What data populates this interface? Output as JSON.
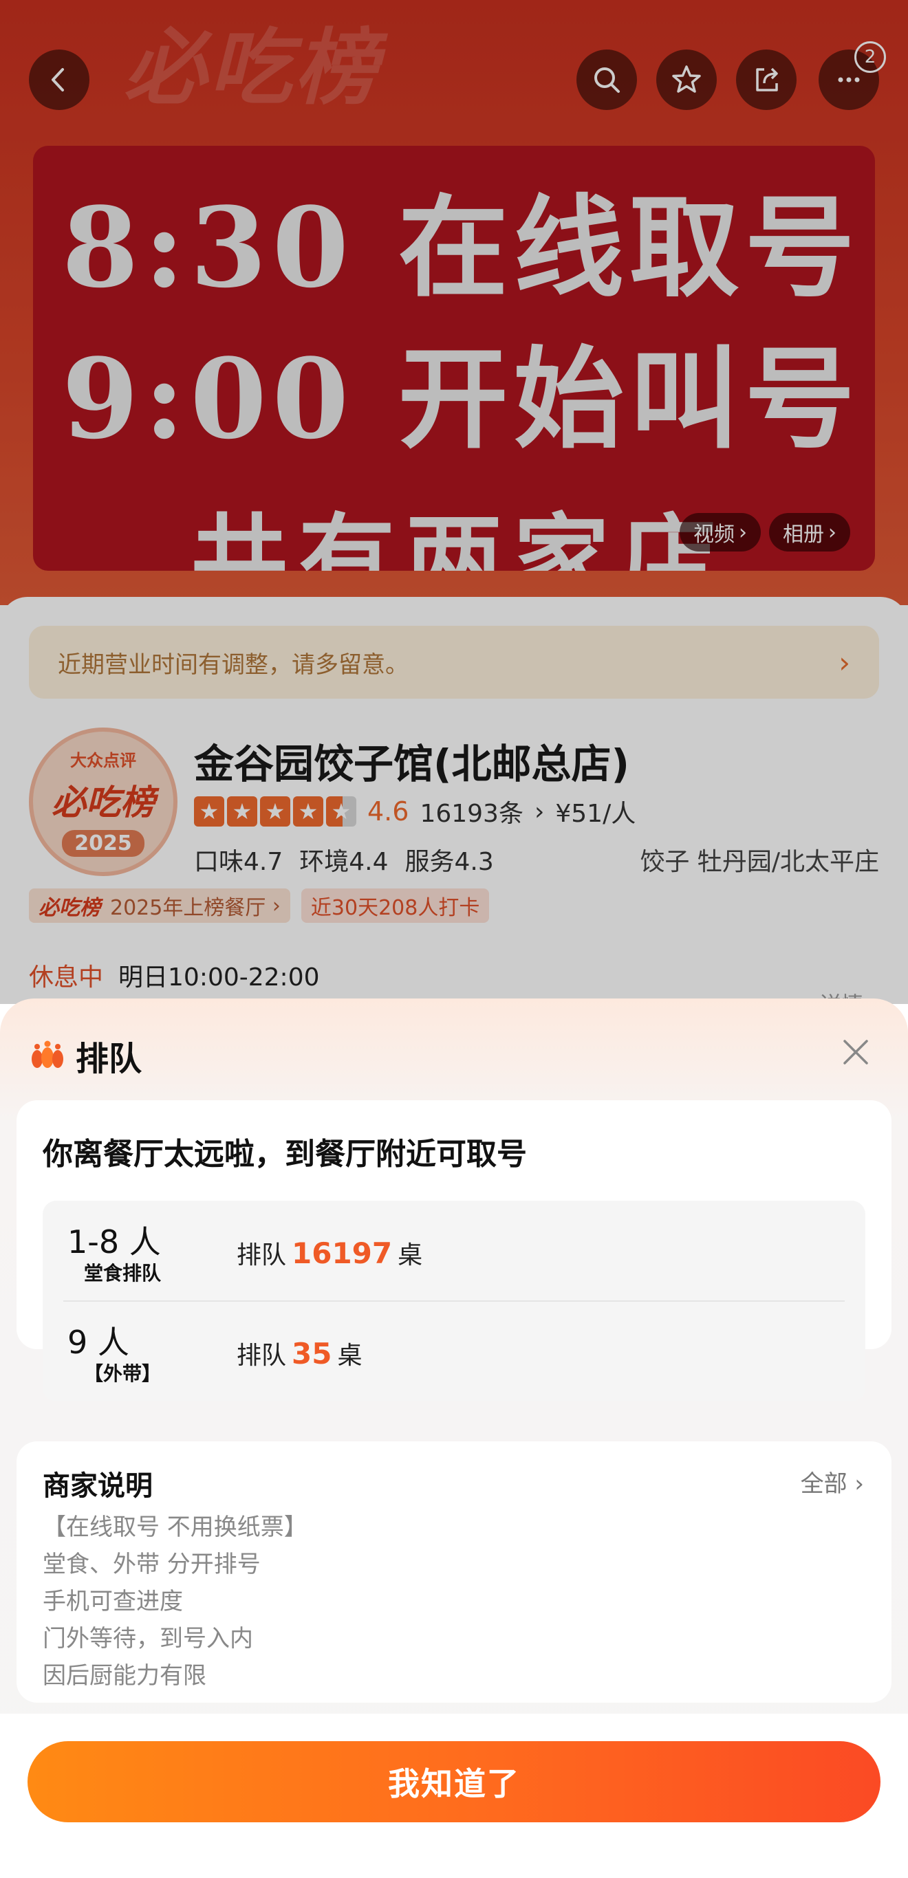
{
  "header": {
    "brand_watermark": "必吃榜",
    "more_badge": "2",
    "icons": [
      "back-icon",
      "search-icon",
      "star-icon",
      "share-icon",
      "more-icon"
    ]
  },
  "banner": {
    "line1": "8:30 在线取号",
    "line2": "9:00 开始叫号",
    "line3": "共有两家店",
    "video_label": "视频",
    "album_label": "相册"
  },
  "notice": {
    "text": "近期营业时间有调整，请多留意。"
  },
  "shop": {
    "badge_top": "大众点评",
    "badge_mid": "必吃榜",
    "badge_year": "2025",
    "name": "金谷园饺子馆(北邮总店)",
    "rating": "4.6",
    "rating_stars": 4.5,
    "reviews": "16193条",
    "price": "¥51/人",
    "taste": "口味4.7",
    "env": "环境4.4",
    "service": "服务4.3",
    "category_area": "饺子 牡丹园/北太平庄",
    "tag_logo": "必吃榜",
    "tag_list": "2025年上榜餐厅",
    "tag_checkin": "近30天208人打卡",
    "status": "休息中",
    "hours": "明日10:00-22:00",
    "detail_link": "详情"
  },
  "sheet": {
    "title": "排队",
    "distance_notice": "你离餐厅太远啦，到餐厅附近可取号",
    "queues": [
      {
        "size": "1-8 人",
        "type": "堂食排队",
        "prefix": "排队",
        "count": "16197",
        "suffix": "桌"
      },
      {
        "size": "9 人",
        "type": "【外带】",
        "prefix": "排队",
        "count": "35",
        "suffix": "桌"
      }
    ],
    "merchant": {
      "title": "商家说明",
      "all_label": "全部",
      "lines": [
        "【在线取号  不用换纸票】",
        "堂食、外带 分开排号",
        "手机可查进度",
        "门外等待，到号入内",
        "因后厨能力有限"
      ]
    },
    "confirm_label": "我知道了"
  },
  "colors": {
    "accent": "#ef5a26",
    "brand_red": "#b0141f",
    "button_start": "#ff8a14",
    "button_end": "#fb4a24"
  }
}
